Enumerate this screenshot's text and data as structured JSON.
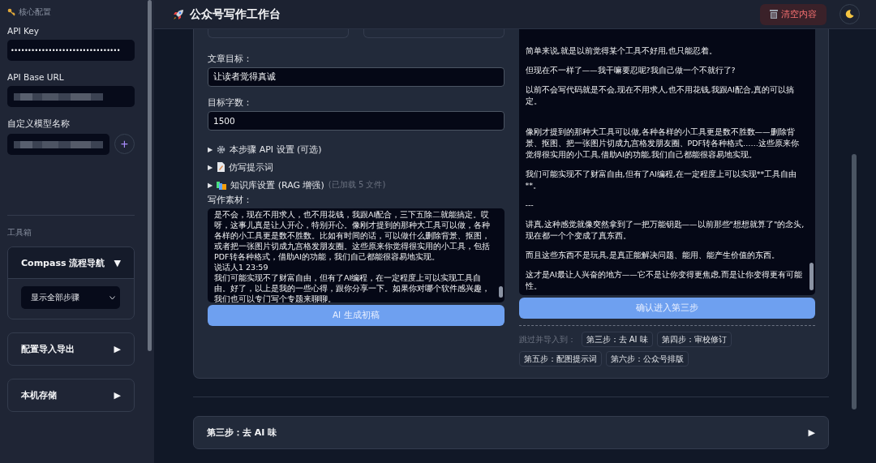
{
  "sidebar": {
    "section_title": "核心配置",
    "fields": [
      {
        "label": "API Key",
        "kind": "password",
        "value": "••••••••••••••••••••••••••••••••"
      },
      {
        "label": "API Base URL",
        "kind": "redacted"
      },
      {
        "label": "自定义模型名称",
        "kind": "redacted_add",
        "add": "+"
      }
    ],
    "toolbox_title": "工具箱",
    "panels": [
      {
        "title": "Compass 流程导航",
        "marker": "▼",
        "expanded": true,
        "select": "显示全部步骤"
      },
      {
        "title": "配置导入导出",
        "marker": "▶",
        "expanded": false
      },
      {
        "title": "本机存储",
        "marker": "▶",
        "expanded": false
      }
    ]
  },
  "header": {
    "title": "公众号写作工作台",
    "clear_button": "清空内容"
  },
  "step2": {
    "left": {
      "fields": [
        {
          "label": "文章目标：",
          "value": "让读者觉得真诚"
        },
        {
          "label": "目标字数：",
          "value": "1500"
        }
      ],
      "sections": [
        {
          "marker": "▶",
          "title": "本步骤 API 设置 (可选)"
        },
        {
          "marker": "▶",
          "title": "仿写提示词"
        },
        {
          "marker": "▶",
          "title": "知识库设置 (RAG 增强)",
          "hint": "(已加载 5 文件)"
        }
      ],
      "material_label": "写作素材：",
      "material": [
        "是不会，现在不用求人，也不用花钱，我跟AI配合，三下五除二就能搞定。哎呀，这事儿真是让人开心，特别开心。像刚才提到的那种大工具可以做，各种各样的小工具更是数不胜数。比如有时间的话，可以做什么删除背景、抠图，或者把一张图片切成九宫格发朋友圈。这些原来你觉得很实用的小工具，包括PDF转各种格式，借助AI的功能，我们自己都能很容易地实现。",
        "说话人1 23:59",
        "我们可能实现不了财富自由，但有了AI编程，在一定程度上可以实现工具自由。好了，以上是我的一些心得，跟你分享一下。如果你对哪个软件感兴趣，我们也可以专门写个专题来聊聊。"
      ],
      "button": "AI 生成初稿"
    },
    "right": {
      "draft": [
        "简单来说,就是以前觉得某个工具不好用,也只能忍着。",
        "但现在不一样了——我干嘛要忍呢?我自己做一个不就行了?",
        "以前不会写代码就是不会,现在不用求人,也不用花钱,我跟AI配合,真的可以搞定。",
        "像刚才提到的那种大工具可以做,各种各样的小工具更是数不胜数——删除背景、抠图、把一张图片切成九宫格发朋友圈、PDF转各种格式……这些原来你觉得很实用的小工具,借助AI的功能,我们自己都能很容易地实现。",
        "我们可能实现不了财富自由,但有了AI编程,在一定程度上可以实现**工具自由**。",
        "---",
        "讲真,这种感觉就像突然拿到了一把万能钥匙——以前那些\"想想就算了\"的念头,现在都一个个变成了真东西。",
        "而且这些东西不是玩具,是真正能解决问题、能用、能产生价值的东西。",
        "这才是AI最让人兴奋的地方——它不是让你变得更焦虑,而是让你变得更有可能性。"
      ],
      "button": "确认进入第三步",
      "skip_label": "跳过并导入到：",
      "skip_targets": [
        "第三步：去 AI 味",
        "第四步：审校修订",
        "第五步：配图提示词",
        "第六步：公众号排版"
      ]
    }
  },
  "steps": [
    {
      "title": "第三步：去 AI 味",
      "marker": "▶"
    }
  ]
}
